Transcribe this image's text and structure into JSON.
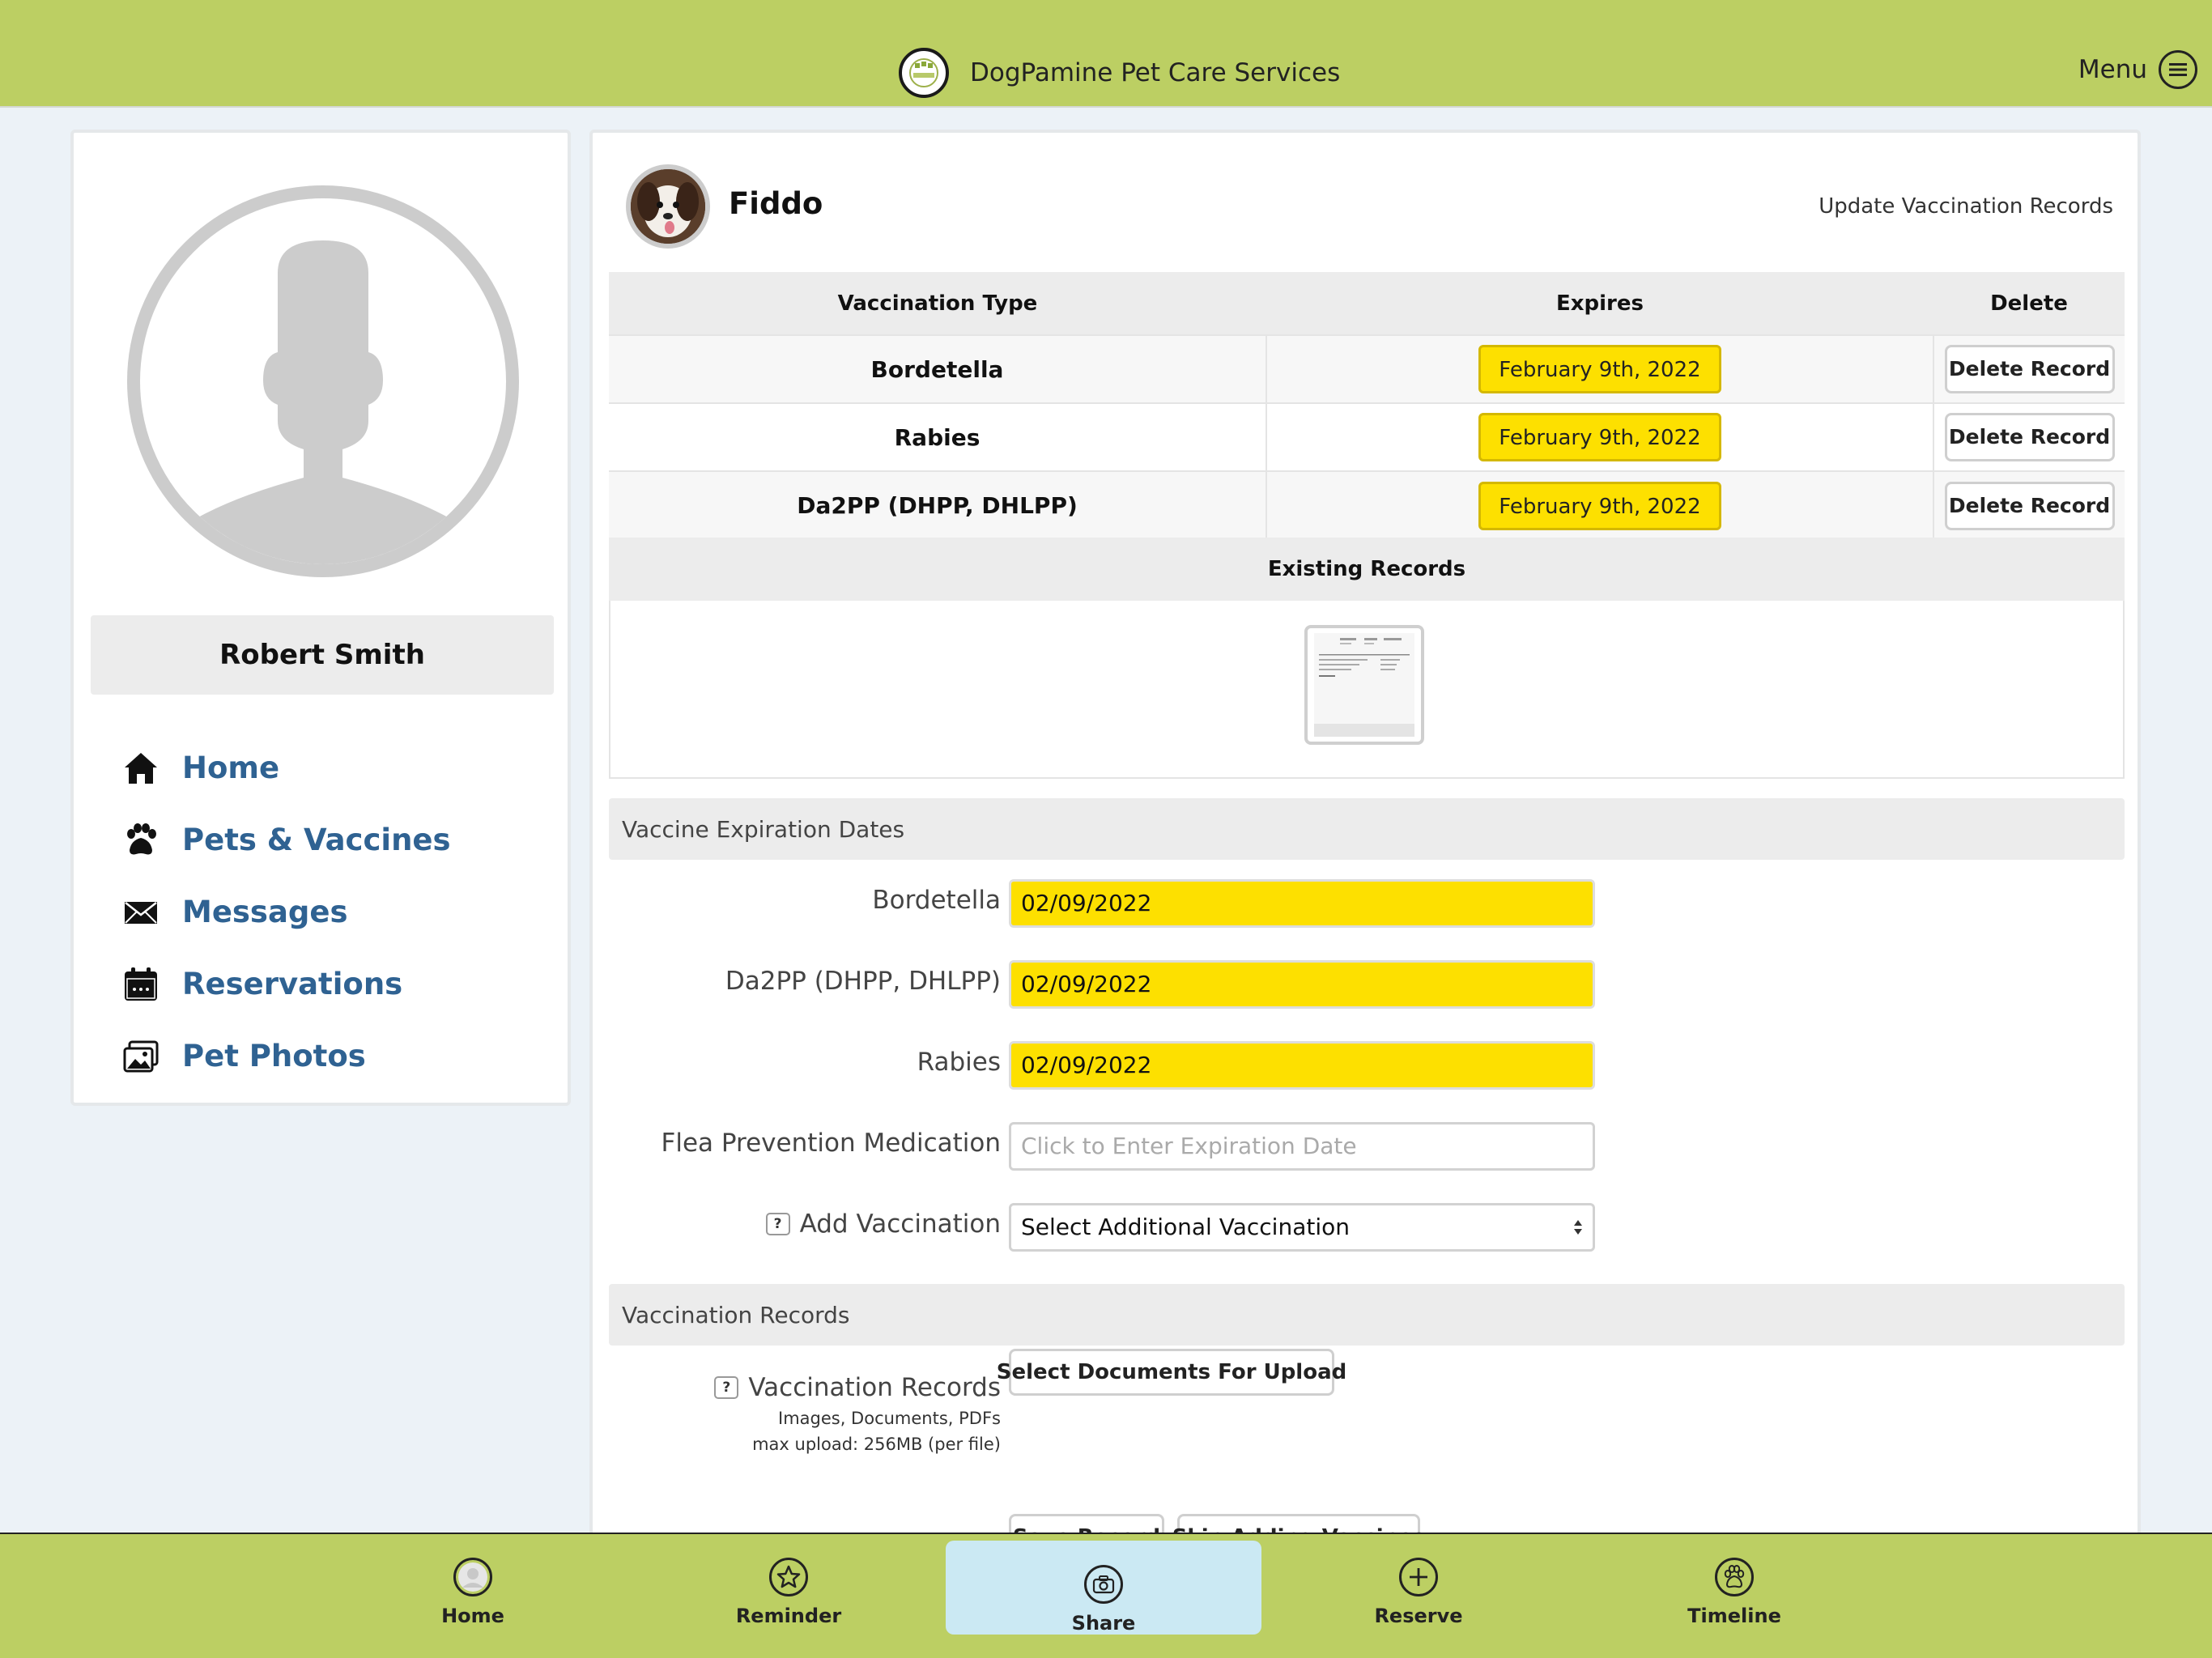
{
  "header": {
    "title": "DogPamine Pet Care Services",
    "menu_label": "Menu"
  },
  "sidebar": {
    "user_name": "Robert Smith",
    "items": [
      {
        "label": "Home",
        "icon": "home-icon"
      },
      {
        "label": "Pets & Vaccines",
        "icon": "paw-icon"
      },
      {
        "label": "Messages",
        "icon": "envelope-icon"
      },
      {
        "label": "Reservations",
        "icon": "calendar-icon"
      },
      {
        "label": "Pet Photos",
        "icon": "photos-icon"
      }
    ]
  },
  "pet": {
    "name": "Fiddo",
    "update_link": "Update Vaccination Records"
  },
  "vaccination_table": {
    "headers": [
      "Vaccination Type",
      "Expires",
      "Delete"
    ],
    "rows": [
      {
        "type": "Bordetella",
        "expires": "February 9th, 2022",
        "action": "Delete Record"
      },
      {
        "type": "Rabies",
        "expires": "February 9th, 2022",
        "action": "Delete Record"
      },
      {
        "type": "Da2PP (DHPP, DHLPP)",
        "expires": "February 9th, 2022",
        "action": "Delete Record"
      }
    ],
    "existing_records_label": "Existing Records"
  },
  "expiration_section": {
    "title": "Vaccine Expiration Dates",
    "fields": [
      {
        "label": "Bordetella",
        "value": "02/09/2022"
      },
      {
        "label": "Da2PP (DHPP, DHLPP)",
        "value": "02/09/2022"
      },
      {
        "label": "Rabies",
        "value": "02/09/2022"
      },
      {
        "label": "Flea Prevention Medication",
        "value": "",
        "placeholder": "Click to Enter Expiration Date"
      }
    ],
    "add_vaccination_label": "Add Vaccination",
    "add_vaccination_help": "?",
    "add_vaccination_selected": "Select Additional Vaccination"
  },
  "records_section": {
    "title": "Vaccination Records",
    "label": "Vaccination Records",
    "help": "?",
    "sub1": "Images, Documents, PDFs",
    "sub2": "max upload: 256MB (per file)",
    "upload_button": "Select Documents For Upload",
    "save_button": "Save Record",
    "skip_button": "Skip Adding Vaccines"
  },
  "tabbar": {
    "items": [
      {
        "label": "Home",
        "icon": "home-avatar-icon"
      },
      {
        "label": "Reminder",
        "icon": "star-icon"
      },
      {
        "label": "Share",
        "icon": "camera-icon"
      },
      {
        "label": "Reserve",
        "icon": "plus-icon"
      },
      {
        "label": "Timeline",
        "icon": "paw-icon"
      }
    ],
    "active": "Share"
  },
  "colors": {
    "brand_green": "#bccf63",
    "highlight_yellow": "#fde000",
    "link_blue": "#2f6292",
    "active_tab": "#cbe9f3"
  }
}
